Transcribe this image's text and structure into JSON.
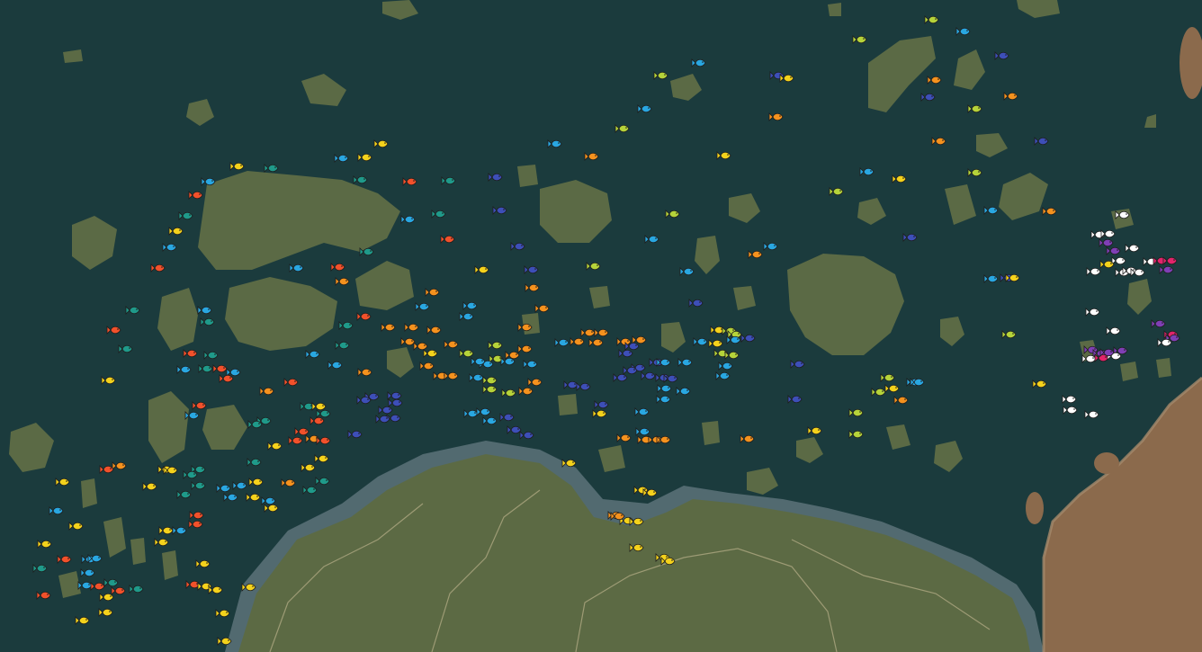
{
  "map": {
    "kind": "fishing-spots-map",
    "fish_icon": "fish-icon",
    "colors": {
      "water": "#1b3b3d",
      "island": "#5b6a45",
      "desert": "#8b6a4c",
      "shallows": "#6a7f86"
    }
  },
  "legend_colors": {
    "yellow": "#f4d21c",
    "orange": "#f5921e",
    "red": "#f2512b",
    "teal": "#1f9a8a",
    "cyan": "#29a7e1",
    "blue": "#3d4fb8",
    "lime": "#b6d33a",
    "white": "#ffffff",
    "purple": "#7f3fb5",
    "magenta": "#e2246b"
  }
}
